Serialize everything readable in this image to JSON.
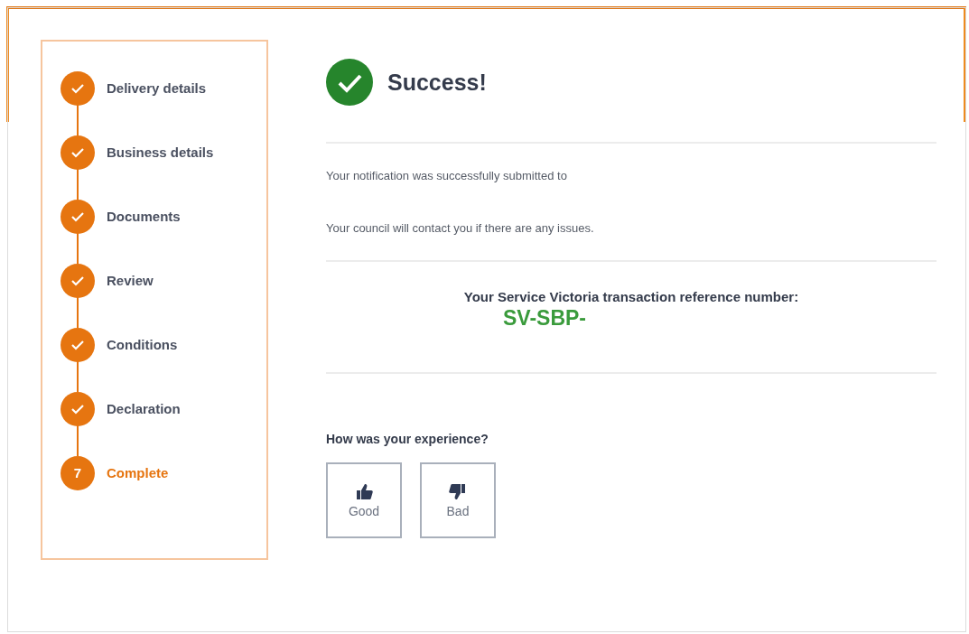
{
  "steps": [
    {
      "label": "Delivery details",
      "completed": true,
      "current": false
    },
    {
      "label": "Business details",
      "completed": true,
      "current": false
    },
    {
      "label": "Documents",
      "completed": true,
      "current": false
    },
    {
      "label": "Review",
      "completed": true,
      "current": false
    },
    {
      "label": "Conditions",
      "completed": true,
      "current": false
    },
    {
      "label": "Declaration",
      "completed": true,
      "current": false
    },
    {
      "label": "Complete",
      "completed": false,
      "current": true,
      "number": "7"
    }
  ],
  "result": {
    "title": "Success!",
    "messages": [
      "Your notification was successfully submitted to",
      "Your council will contact you if there are any issues."
    ],
    "reference_label": "Your Service Victoria transaction reference number:",
    "reference_number": "SV-SBP-"
  },
  "feedback": {
    "question": "How was your experience?",
    "options": [
      {
        "kind": "good",
        "label": "Good"
      },
      {
        "kind": "bad",
        "label": "Bad"
      }
    ]
  }
}
